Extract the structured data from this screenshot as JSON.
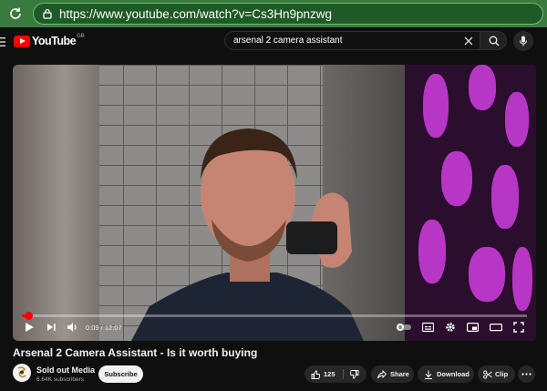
{
  "browser": {
    "url": "https://www.youtube.com/watch?v=Cs3Hn9pnzwg"
  },
  "header": {
    "logo_text": "YouTube",
    "country": "GB",
    "search_query": "arsenal 2 camera assistant"
  },
  "player": {
    "current_time": "0:09",
    "duration": "12:07",
    "time_display": "0:09 / 12:07",
    "progress_fraction": 0.0124
  },
  "video": {
    "title": "Arsenal 2 Camera Assistant - Is it worth buying",
    "channel_name": "Sold out Media",
    "subscribers": "6.64K subscribers",
    "subscribe_label": "Subscribe"
  },
  "actions": {
    "like_count": "125",
    "share_label": "Share",
    "download_label": "Download",
    "clip_label": "Clip"
  },
  "colors": {
    "brand": "#ff0000",
    "browser_bar": "#3a7a3f",
    "background": "#0f0f0f"
  }
}
